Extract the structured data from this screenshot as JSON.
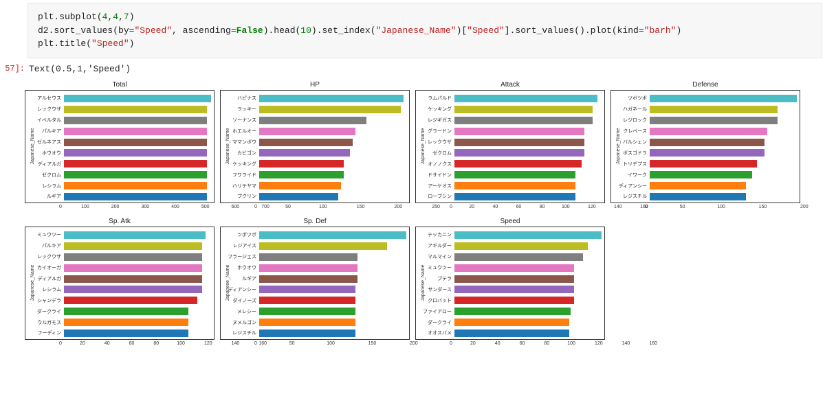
{
  "code_lines": {
    "l1_pre": "plt.subplot(",
    "l1_args": [
      "4",
      "4",
      "7"
    ],
    "l1_post": ")",
    "l2_pre": "d2.sort_values(by=",
    "l2_str1": "\"Speed\"",
    "l2_asc": ", ascending=",
    "l2_false": "False",
    "l2_head": ").head(",
    "l2_ten": "10",
    "l2_setidx": ").set_index(",
    "l2_str2": "\"Japanese_Name\"",
    "l2_mid": ")",
    "l2_open1": "[",
    "l2_str3": "\"Speed\"",
    "l2_mid2": "].sort_values().plot(kind=",
    "l2_str4": "\"barh\"",
    "l2_end": ")",
    "l3_pre": "plt.title(",
    "l3_str": "\"Speed\"",
    "l3_post": ")"
  },
  "output": {
    "prompt": "57]:",
    "text": "Text(0.5,1,'Speed')"
  },
  "ylabel": "Japanese_Name",
  "chart_data": [
    {
      "type": "bar",
      "orientation": "h",
      "title": "Total",
      "ylabel": "Japanese_Name",
      "xlim": [
        0,
        700
      ],
      "xticks": [
        0,
        100,
        200,
        300,
        400,
        500,
        600,
        700
      ],
      "categories": [
        "アルセウス",
        "レックウザ",
        "イベルタル",
        "パルキア",
        "ゼルネアス",
        "ホウオウ",
        "ディアルガ",
        "ゼクロム",
        "レシラム",
        "ルギア"
      ],
      "values": [
        720,
        680,
        680,
        680,
        680,
        680,
        680,
        680,
        680,
        680
      ]
    },
    {
      "type": "bar",
      "orientation": "h",
      "title": "HP",
      "ylabel": "Japanese_Name",
      "xlim": [
        0,
        260
      ],
      "xticks": [
        0,
        50,
        100,
        150,
        200,
        250
      ],
      "categories": [
        "ハピナス",
        "ラッキー",
        "ソーナンス",
        "ホエルオー",
        "ママンボウ",
        "カビゴン",
        "ケッキング",
        "フワライド",
        "ハリテヤマ",
        "プクリン"
      ],
      "values": [
        255,
        250,
        190,
        170,
        165,
        160,
        150,
        150,
        144,
        140
      ]
    },
    {
      "type": "bar",
      "orientation": "h",
      "title": "Attack",
      "ylabel": "Japanese_Name",
      "xlim": [
        0,
        170
      ],
      "xticks": [
        0,
        20,
        40,
        60,
        80,
        100,
        120,
        140,
        160
      ],
      "categories": [
        "ラムパルド",
        "ケッキング",
        "レジギガス",
        "グラードン",
        "レックウザ",
        "ゼクロム",
        "オノノクス",
        "ドサイドン",
        "アーケオス",
        "ローブシン"
      ],
      "values": [
        165,
        160,
        160,
        150,
        150,
        150,
        147,
        140,
        140,
        140
      ]
    },
    {
      "type": "bar",
      "orientation": "h",
      "title": "Defense",
      "ylabel": "Japanese_Name",
      "xlim": [
        0,
        230
      ],
      "xticks": [
        0,
        50,
        100,
        150,
        200
      ],
      "categories": [
        "ツボツボ",
        "ハガネール",
        "レジロック",
        "クレベース",
        "バルシェン",
        "ボスゴドラ",
        "トリデプス",
        "イワーク",
        "ディアンシー",
        "レジスチル"
      ],
      "values": [
        230,
        200,
        200,
        184,
        180,
        180,
        168,
        160,
        150,
        150
      ]
    },
    {
      "type": "bar",
      "orientation": "h",
      "title": "Sp. Atk",
      "ylabel": "Japanese_Name",
      "xlim": [
        0,
        160
      ],
      "xticks": [
        0,
        20,
        40,
        60,
        80,
        100,
        120,
        140,
        160
      ],
      "categories": [
        "ミュウツー",
        "パルキア",
        "レックウザ",
        "カイオーガ",
        "ディアルガ",
        "レシラム",
        "シャンデラ",
        "ダークライ",
        "ウルガモス",
        "フーディン"
      ],
      "values": [
        154,
        150,
        150,
        150,
        150,
        150,
        145,
        135,
        135,
        135
      ]
    },
    {
      "type": "bar",
      "orientation": "h",
      "title": "Sp. Def",
      "ylabel": "Japanese_Name",
      "xlim": [
        0,
        230
      ],
      "xticks": [
        0,
        50,
        100,
        150,
        200
      ],
      "categories": [
        "ツボツボ",
        "レジアイス",
        "フラージェス",
        "ホウオウ",
        "ルギア",
        "ディアンシー",
        "ダイノーズ",
        "メレシー",
        "ヌメルゴン",
        "レジスチル"
      ],
      "values": [
        230,
        200,
        154,
        154,
        154,
        150,
        150,
        150,
        150,
        150
      ]
    },
    {
      "type": "bar",
      "orientation": "h",
      "title": "Speed",
      "ylabel": "Japanese_Name",
      "xlim": [
        0,
        160
      ],
      "xticks": [
        0,
        20,
        40,
        60,
        80,
        100,
        120,
        140,
        160
      ],
      "categories": [
        "テッカニン",
        "アギルダー",
        "マルマイン",
        "ミュウツー",
        "プテラ",
        "サンダース",
        "クロバット",
        "ファイアロー",
        "ダークライ",
        "オオスバメ"
      ],
      "values": [
        160,
        145,
        140,
        130,
        130,
        130,
        130,
        126,
        125,
        125
      ]
    }
  ],
  "colors": [
    "#4abdc6",
    "#bcbd22",
    "#7f7f7f",
    "#e377c2",
    "#8c564b",
    "#9467bd",
    "#d62728",
    "#2ca02c",
    "#ff7f0e",
    "#1f77b4"
  ]
}
